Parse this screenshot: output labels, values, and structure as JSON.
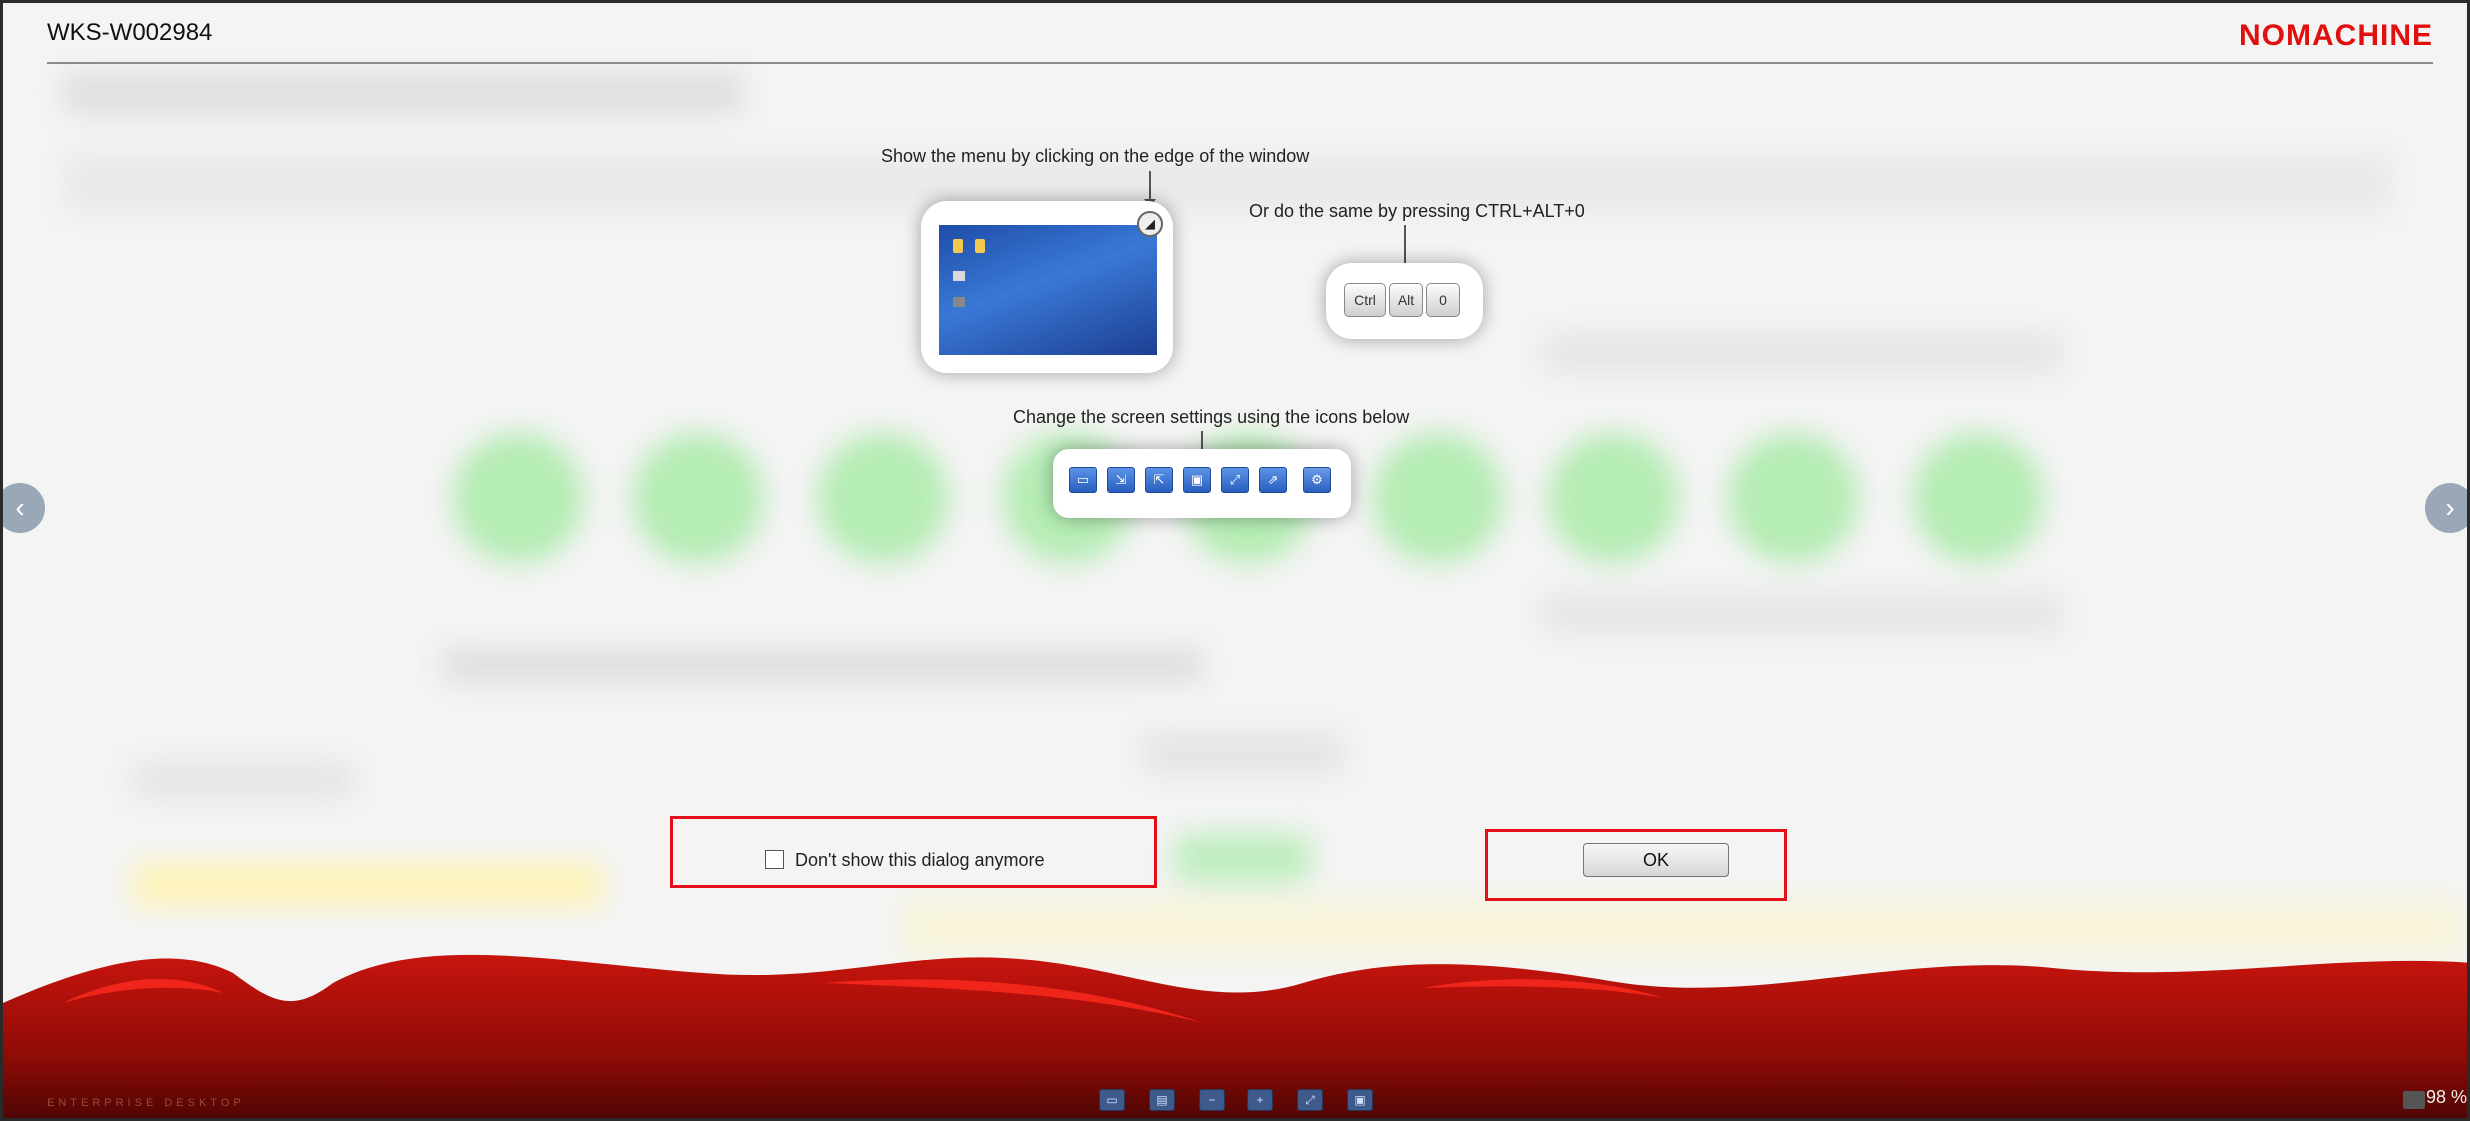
{
  "header": {
    "title": "WKS-W002984",
    "logo": "NOMACHINE"
  },
  "tips": {
    "menu_caption": "Show the menu by clicking on the edge of the window",
    "shortcut_caption": "Or do the same by pressing CTRL+ALT+0",
    "keys": [
      "Ctrl",
      "Alt",
      "0"
    ],
    "screen_caption": "Change the screen settings using the icons below"
  },
  "screen_icons": [
    "fit-window-icon",
    "scale-icon",
    "resize-icon",
    "viewport-icon",
    "fullscreen-icon",
    "scroll-icon",
    "display-settings-icon"
  ],
  "dialog": {
    "checkbox_label": "Don't show this dialog anymore",
    "checkbox_checked": false,
    "ok_label": "OK"
  },
  "nav": {
    "prev_label": "‹",
    "next_label": "›"
  },
  "footer": {
    "brand_text": "ENTERPRISE DESKTOP",
    "zoom": "98 %"
  },
  "colors": {
    "brand_red": "#e1100f",
    "highlight_box": "#e3101b",
    "icon_blue": "#2a5fbf"
  }
}
